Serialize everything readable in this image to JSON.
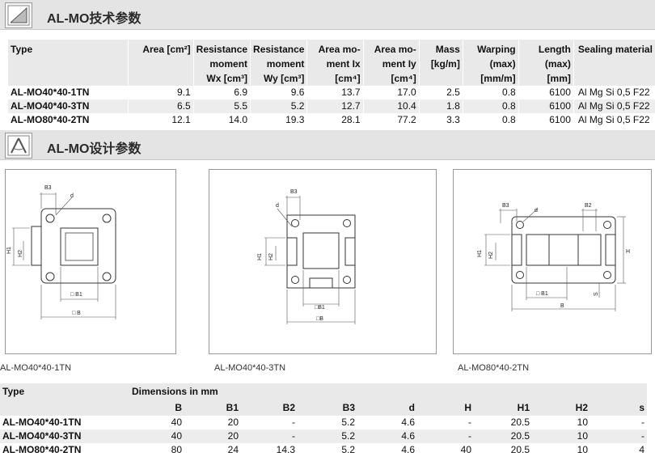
{
  "sections": {
    "tech_title": "AL-MO技术参数",
    "design_title": "AL-MO设计参数"
  },
  "spec_table": {
    "headers": [
      [
        "Type"
      ],
      [
        "Area [cm²]"
      ],
      [
        "Resistance",
        "moment",
        "Wx [cm³]"
      ],
      [
        "Resistance",
        "moment",
        "Wy [cm³]"
      ],
      [
        "Area mo-",
        "ment Ix",
        "[cm⁴]"
      ],
      [
        "Area mo-",
        "ment Iy",
        "[cm⁴]"
      ],
      [
        "Mass",
        "[kg/m]"
      ],
      [
        "Warping",
        "(max)",
        "[mm/m]"
      ],
      [
        "Length",
        "(max)",
        "[mm]"
      ],
      [
        "Sealing material"
      ]
    ],
    "rows": [
      [
        "AL-MO40*40-1TN",
        "9.1",
        "6.9",
        "9.6",
        "13.7",
        "17.0",
        "2.5",
        "0.8",
        "6100",
        "Al Mg Si 0,5 F22"
      ],
      [
        "AL-MO40*40-3TN",
        "6.5",
        "5.5",
        "5.2",
        "12.7",
        "10.4",
        "1.8",
        "0.8",
        "6100",
        "Al Mg Si 0,5 F22"
      ],
      [
        "AL-MO80*40-2TN",
        "12.1",
        "14.0",
        "19.3",
        "28.1",
        "77.2",
        "3.3",
        "0.8",
        "6100",
        "Al Mg Si 0,5 F22"
      ]
    ]
  },
  "drawings": {
    "panel1": {
      "caption": "AL-MO40*40-1TN",
      "labels": {
        "b3": "B3",
        "d": "d",
        "h1": "H1",
        "h2": "H2",
        "b1": "□ B1",
        "b": "□ B"
      }
    },
    "panel2": {
      "caption": "AL-MO40*40-3TN",
      "labels": {
        "b3": "B3",
        "d": "d",
        "h1": "H1",
        "h2": "H2",
        "b1": "□B1",
        "b": "□B"
      }
    },
    "panel3": {
      "caption": "AL-MO80*40-2TN",
      "labels": {
        "b3": "B3",
        "d": "d",
        "b2": "B2",
        "h1": "H1",
        "h2": "H2",
        "h": "H",
        "s": "S",
        "b1": "□ B1",
        "b": "B"
      }
    }
  },
  "dims_table": {
    "type_label": "Type",
    "group_label": "Dimensions in mm",
    "columns": [
      "B",
      "B1",
      "B2",
      "B3",
      "d",
      "H",
      "H1",
      "H2",
      "s"
    ],
    "rows": [
      [
        "AL-MO40*40-1TN",
        "40",
        "20",
        "-",
        "5.2",
        "4.6",
        "-",
        "20.5",
        "10",
        "-"
      ],
      [
        "AL-MO40*40-3TN",
        "40",
        "20",
        "-",
        "5.2",
        "4.6",
        "-",
        "20.5",
        "10",
        "-"
      ],
      [
        "AL-MO80*40-2TN",
        "80",
        "24",
        "14.3",
        "5.2",
        "4.6",
        "40",
        "20.5",
        "10",
        "4"
      ]
    ]
  }
}
